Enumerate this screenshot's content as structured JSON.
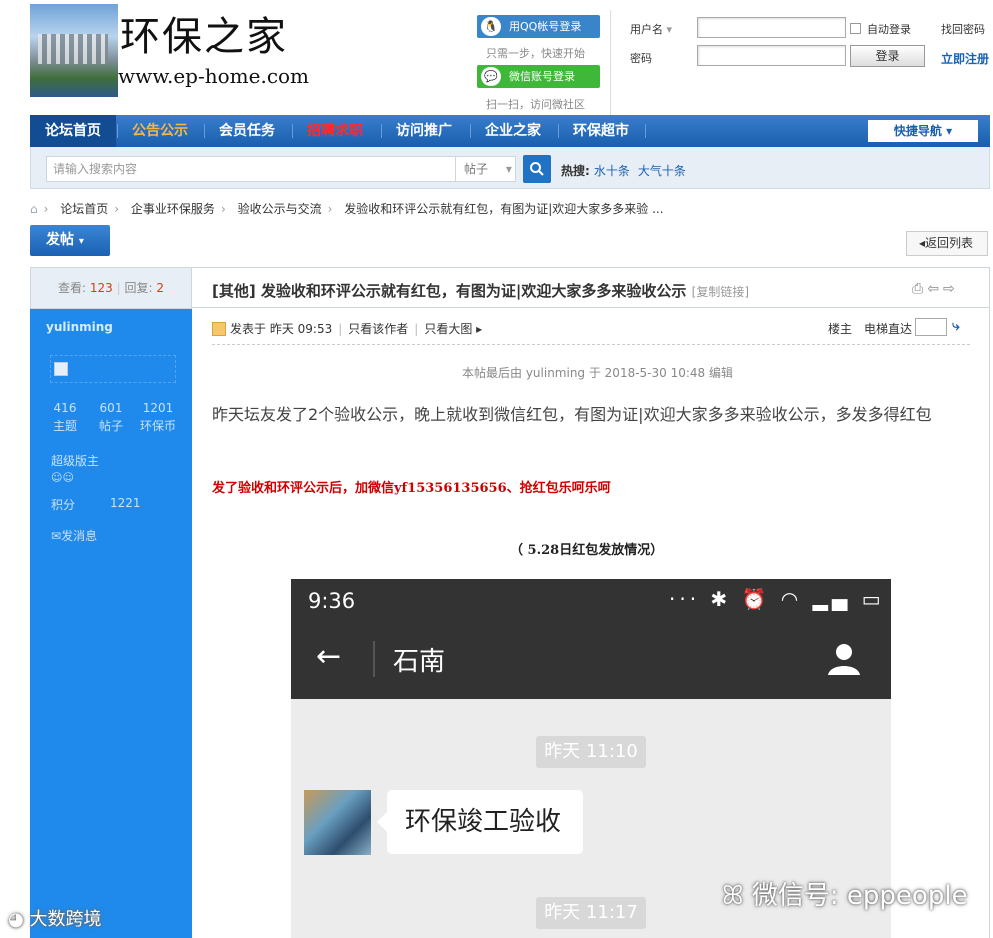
{
  "header": {
    "logo_title": "环保之家",
    "logo_url": "www.ep-home.com",
    "qq_login": "用QQ帐号登录",
    "qq_sub": "只需一步，快速开始",
    "wechat_login": "微信账号登录",
    "wechat_sub": "扫一扫，访问微社区",
    "username_label": "用户名",
    "password_label": "密码",
    "auto_login": "自动登录",
    "login_button": "登录",
    "find_password": "找回密码",
    "register": "立即注册"
  },
  "nav": {
    "items": [
      "论坛首页",
      "公告公示",
      "会员任务",
      "招聘求职",
      "访问推广",
      "企业之家",
      "环保超市"
    ],
    "quick_nav": "快捷导航"
  },
  "search": {
    "placeholder": "请输入搜索内容",
    "type": "帖子",
    "hot_label": "热搜:",
    "hot1": "水十条",
    "hot2": "大气十条"
  },
  "breadcrumb": {
    "b1": "论坛首页",
    "b2": "企事业环保服务",
    "b3": "验收公示与交流",
    "b4": "发验收和环评公示就有红包，有图为证|欢迎大家多多来验 ..."
  },
  "actions": {
    "post_button": "发帖",
    "back_button": "返回列表"
  },
  "sidebar": {
    "views_label": "查看:",
    "views": "123",
    "replies_label": "回复:",
    "replies": "2",
    "username": "yulinming",
    "themes": "416",
    "themes_label": "主题",
    "posts": "601",
    "posts_label": "帖子",
    "coins": "1201",
    "coins_label": "环保币",
    "role": "超级版主",
    "score_label": "积分",
    "score": "1221",
    "message": "发消息"
  },
  "post": {
    "title": "[其他] 发验收和环评公示就有红包，有图为证|欢迎大家多多来验收公示",
    "copy_link": "[复制链接]",
    "posted": "发表于 昨天 09:53",
    "only_author": "只看该作者",
    "big_image": "只看大图",
    "floor": "楼主",
    "elevator": "电梯直达",
    "edited": "本帖最后由 yulinming 于 2018-5-30 10:48 编辑",
    "body": "昨天坛友发了2个验收公示，晚上就收到微信红包，有图为证|欢迎大家多多来验收公示，多发多得红包",
    "red_text": "发了验收和环评公示后，加微信yf15356135656、抢红包乐呵乐呵",
    "caption": "（ 5.28日红包发放情况）"
  },
  "phone": {
    "time": "9:36",
    "contact": "石南",
    "stamp1": "昨天 11:10",
    "message": "环保竣工验收",
    "stamp2": "昨天 11:17"
  },
  "watermarks": {
    "wechat_id": "微信号: eppeople",
    "brand": "大数跨境"
  }
}
